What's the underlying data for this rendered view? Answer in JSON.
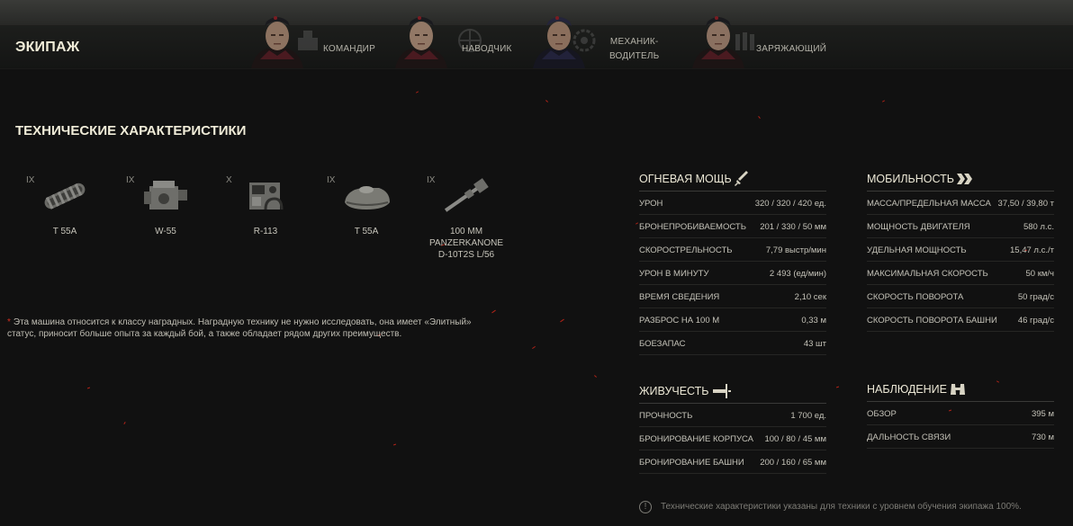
{
  "crew": {
    "title": "ЭКИПАЖ",
    "members": [
      {
        "role": "КОМАНДИР",
        "icon": "commander-icon"
      },
      {
        "role": "НАВОДЧИК",
        "icon": "gunner-icon"
      },
      {
        "role_line1": "МЕХАНИК-",
        "role_line2": "ВОДИТЕЛЬ",
        "icon": "driver-icon"
      },
      {
        "role": "ЗАРЯЖАЮЩИЙ",
        "icon": "loader-icon"
      }
    ]
  },
  "specs": {
    "title": "ТЕХНИЧЕСКИЕ ХАРАКТЕРИСТИКИ",
    "modules": [
      {
        "tier": "IX",
        "name": "T 55A",
        "icon": "tracks-icon"
      },
      {
        "tier": "IX",
        "name": "W-55",
        "icon": "engine-icon"
      },
      {
        "tier": "X",
        "name": "R-113",
        "icon": "radio-icon"
      },
      {
        "tier": "IX",
        "name": "T 55A",
        "icon": "turret-icon"
      },
      {
        "tier": "IX",
        "name_line1": "100 MM",
        "name_line2": "PANZERKANONE",
        "name_line3": "D-10T2S L/56",
        "icon": "gun-icon"
      }
    ],
    "note_star": "*",
    "note": "Эта машина относится к классу наградных. Наградную технику не нужно исследовать, она имеет «Элитный» статус, приносит больше опыта за каждый бой, а также обладает рядом других преимуществ."
  },
  "firepower": {
    "title": "ОГНЕВАЯ МОЩЬ",
    "icon": "sword-icon",
    "rows": [
      {
        "name": "УРОН",
        "value": "320 / 320 / 420 ед."
      },
      {
        "name": "БРОНЕПРОБИВАЕМОСТЬ",
        "value": "201 / 330 / 50 мм"
      },
      {
        "name": "СКОРОСТРЕЛЬНОСТЬ",
        "value": "7,79 выстр/мин"
      },
      {
        "name": "УРОН В МИНУТУ",
        "value": "2 493 (ед/мин)"
      },
      {
        "name": "ВРЕМЯ СВЕДЕНИЯ",
        "value": "2,10 сек"
      },
      {
        "name": "РАЗБРОС НА 100 М",
        "value": "0,33 м"
      },
      {
        "name": "БОЕЗАПАС",
        "value": "43 шт"
      }
    ]
  },
  "survivability": {
    "title": "ЖИВУЧЕСТЬ",
    "icon": "survivability-icon",
    "rows": [
      {
        "name": "ПРОЧНОСТЬ",
        "value": "1 700 ед."
      },
      {
        "name": "БРОНИРОВАНИЕ КОРПУСА",
        "value": "100 / 80 / 45 мм"
      },
      {
        "name": "БРОНИРОВАНИЕ БАШНИ",
        "value": "200 / 160 / 65 мм"
      }
    ]
  },
  "mobility": {
    "title": "МОБИЛЬНОСТЬ",
    "icon": "double-chevron-icon",
    "rows": [
      {
        "name": "МАССА/ПРЕДЕЛЬНАЯ МАССА",
        "value": "37,50 / 39,80 т"
      },
      {
        "name": "МОЩНОСТЬ ДВИГАТЕЛЯ",
        "value": "580 л.с."
      },
      {
        "name": "УДЕЛЬНАЯ МОЩНОСТЬ",
        "value": "15,47 л.с./т"
      },
      {
        "name": "МАКСИМАЛЬНАЯ СКОРОСТЬ",
        "value": "50 км/ч"
      },
      {
        "name": "СКОРОСТЬ ПОВОРОТА",
        "value": "50 град/с"
      },
      {
        "name": "СКОРОСТЬ ПОВОРОТА БАШНИ",
        "value": "46 град/с"
      }
    ]
  },
  "spotting": {
    "title": "НАБЛЮДЕНИЕ",
    "icon": "binoculars-icon",
    "rows": [
      {
        "name": "ОБЗОР",
        "value": "395 м"
      },
      {
        "name": "ДАЛЬНОСТЬ СВЯЗИ",
        "value": "730 м"
      }
    ]
  },
  "footer": {
    "info_glyph": "!",
    "text": "Технические характеристики указаны для техники с уровнем обучения экипажа 100%."
  }
}
